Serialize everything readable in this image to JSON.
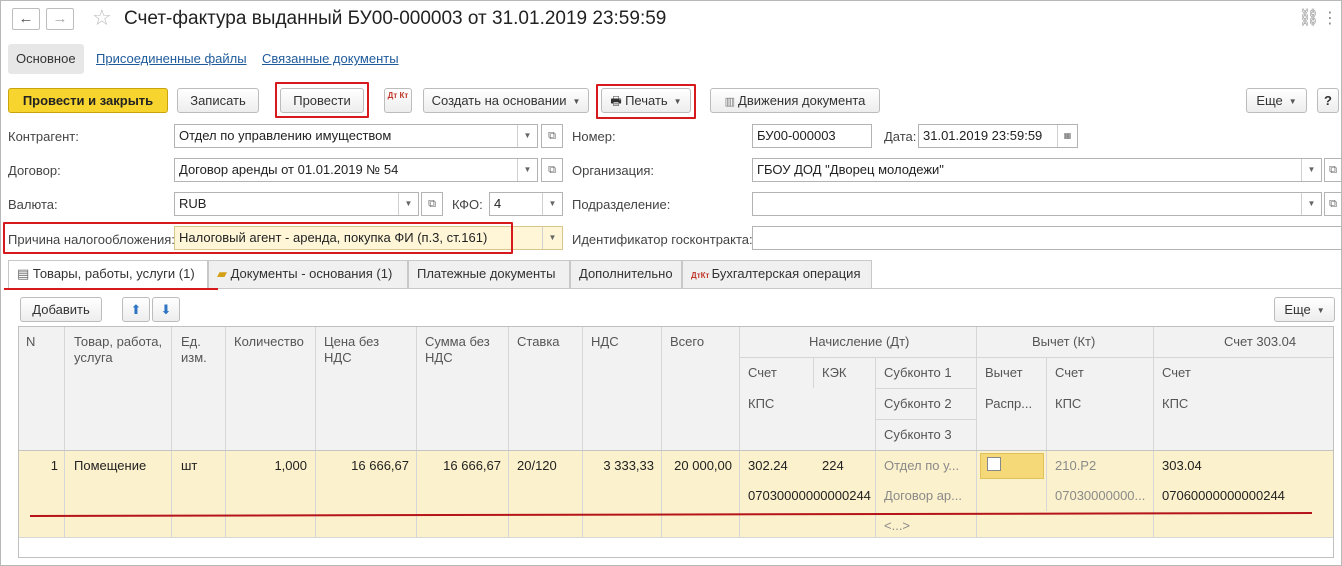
{
  "window": {
    "title": "Счет-фактура выданный БУ00-000003 от 31.01.2019 23:59:59"
  },
  "section_tabs": {
    "main": "Основное",
    "files": "Присоединенные файлы",
    "linked": "Связанные документы"
  },
  "toolbar": {
    "post_close": "Провести и закрыть",
    "save": "Записать",
    "post": "Провести",
    "dtkt": "Дт Кт",
    "create_based": "Создать на основании",
    "print": "Печать",
    "movements": "Движения документа",
    "more": "Еще",
    "help": "?"
  },
  "form": {
    "counterparty_label": "Контрагент:",
    "counterparty_value": "Отдел по управлению имуществом",
    "contract_label": "Договор:",
    "contract_value": "Договор аренды от 01.01.2019 № 54",
    "currency_label": "Валюта:",
    "currency_value": "RUB",
    "kfo_label": "КФО:",
    "kfo_value": "4",
    "tax_reason_label": "Причина налогообложения:",
    "tax_reason_value": "Налоговый агент - аренда, покупка ФИ (п.3, ст.161)",
    "number_label": "Номер:",
    "number_value": "БУ00-000003",
    "date_label": "Дата:",
    "date_value": "31.01.2019 23:59:59",
    "org_label": "Организация:",
    "org_value": "ГБОУ ДОД \"Дворец молодежи\"",
    "dept_label": "Подразделение:",
    "dept_value": "",
    "gov_contract_label": "Идентификатор госконтракта:",
    "gov_contract_value": ""
  },
  "content_tabs": {
    "goods": "Товары, работы, услуги (1)",
    "docs": "Документы - основания (1)",
    "payments": "Платежные документы",
    "extra": "Дополнительно",
    "accounting": "Бухгалтерская операция"
  },
  "table_toolbar": {
    "add": "Добавить",
    "up": "⬆",
    "down": "⬇",
    "more": "Еще"
  },
  "table": {
    "headers": {
      "n": "N",
      "item": "Товар, работа, услуга",
      "unit": "Ед. изм.",
      "qty": "Количество",
      "price": "Цена без НДС",
      "sum": "Сумма без НДС",
      "rate": "Ставка",
      "vat": "НДС",
      "total": "Всего",
      "accrual": "Начисление (Дт)",
      "deduction": "Вычет (Кт)",
      "account30304": "Счет 303.04",
      "acc": "Счет",
      "kek": "КЭК",
      "sub1": "Субконто 1",
      "sub2": "Субконто 2",
      "sub3": "Субконто 3",
      "kps": "КПС",
      "ded": "Вычет",
      "distr": "Распр...",
      "acc2": "Счет",
      "kps2": "КПС",
      "acc3": "Счет",
      "kps3": "КПС"
    },
    "row": {
      "n": "1",
      "item": "Помещение",
      "unit": "шт",
      "qty": "1,000",
      "price": "16 666,67",
      "sum": "16 666,67",
      "rate": "20/120",
      "vat": "3 333,33",
      "total": "20 000,00",
      "acc": "302.24",
      "kek": "224",
      "sub1": "Отдел по у...",
      "kps": "07030000000000244",
      "sub2": "Договор ар...",
      "sub3": "<...>",
      "ded_acc": "210.Р2",
      "ded_kps": "07030000000...",
      "acc3": "303.04",
      "kps3": "07060000000000244"
    }
  },
  "colors": {
    "accent_yellow": "#f7d42e",
    "row_highlight": "#fbf1cc",
    "annotation_red": "#d6191c",
    "link_blue": "#1f5b9b"
  }
}
